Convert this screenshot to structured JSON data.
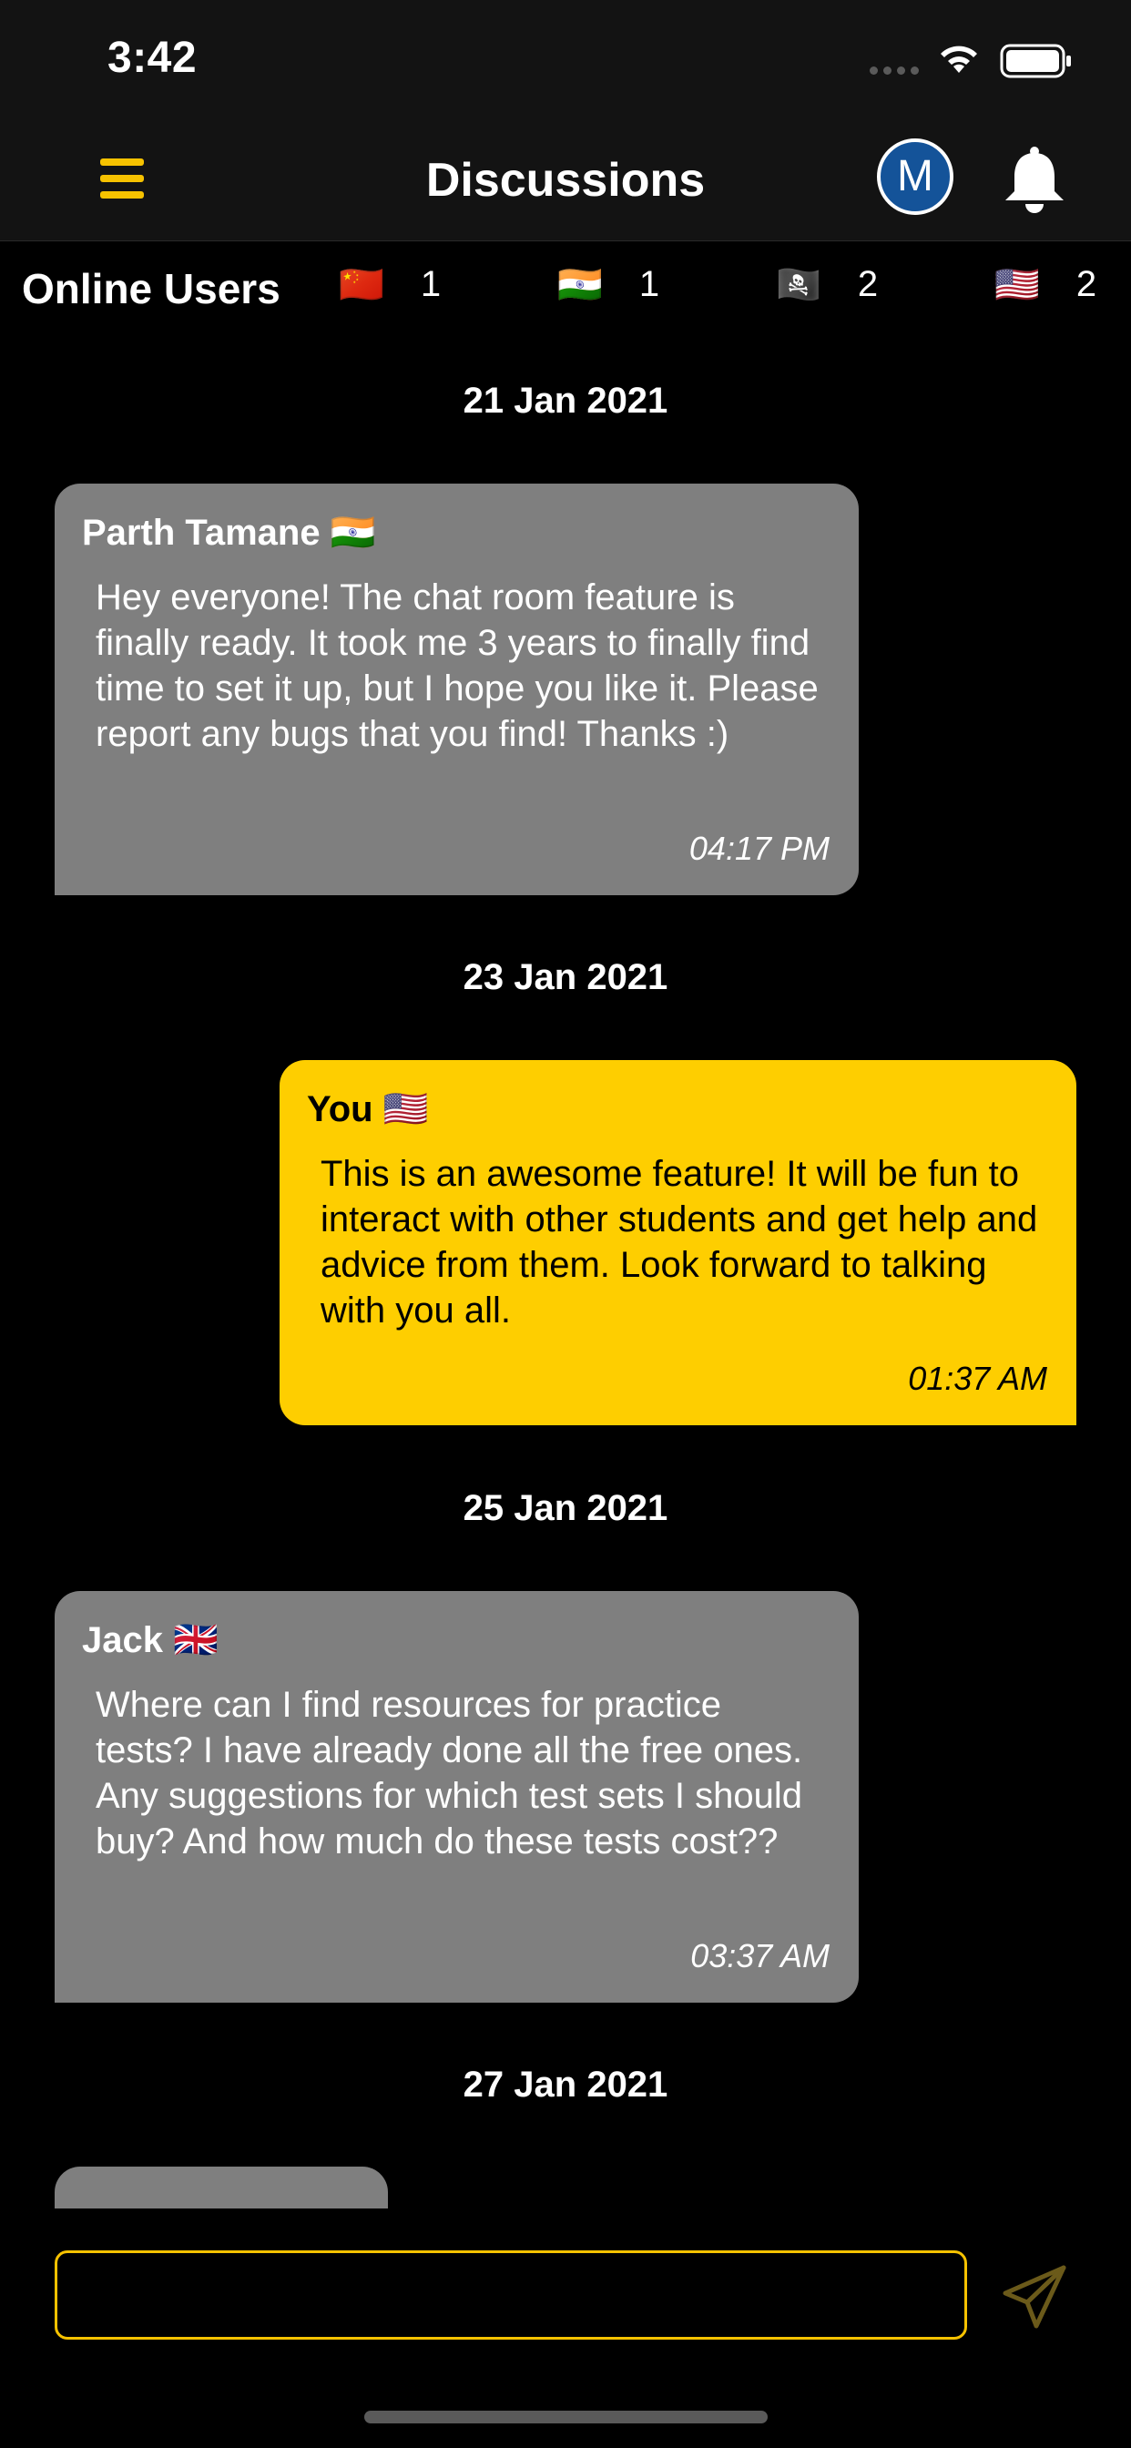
{
  "status": {
    "time": "3:42"
  },
  "nav": {
    "title": "Discussions",
    "avatar_initial": "M"
  },
  "online": {
    "label": "Online Users",
    "flags": [
      {
        "flag": "🇨🇳",
        "count": "1"
      },
      {
        "flag": "🇮🇳",
        "count": "1"
      },
      {
        "flag": "🏴‍☠️",
        "count": "2"
      },
      {
        "flag": "🇺🇸",
        "count": "2"
      }
    ]
  },
  "messages": [
    {
      "date": "21 Jan 2021",
      "sender": "Parth Tamane 🇮🇳",
      "text": "Hey everyone! The chat room feature is finally ready. It took me 3 years to finally find time to set it up, but I hope you like it. Please report any bugs that you find! Thanks :)",
      "time": "04:17 PM"
    },
    {
      "date": "23 Jan 2021",
      "sender": "You 🇺🇸",
      "text": "This is an awesome feature! It will be fun to interact with other students and get help and advice from them. Look forward to talking with you all.",
      "time": "01:37 AM"
    },
    {
      "date": "25 Jan 2021",
      "sender": "Jack 🇬🇧",
      "text": "Where can I find resources for practice tests? I have already done all the free ones. Any suggestions for which test sets I should buy? And how much do these tests cost??",
      "time": "03:37 AM"
    },
    {
      "date": "27 Jan 2021"
    }
  ],
  "composer": {
    "placeholder": ""
  },
  "colors": {
    "accent": "#fece00",
    "bubble_other": "#7f7f7f",
    "avatar": "#145399"
  }
}
